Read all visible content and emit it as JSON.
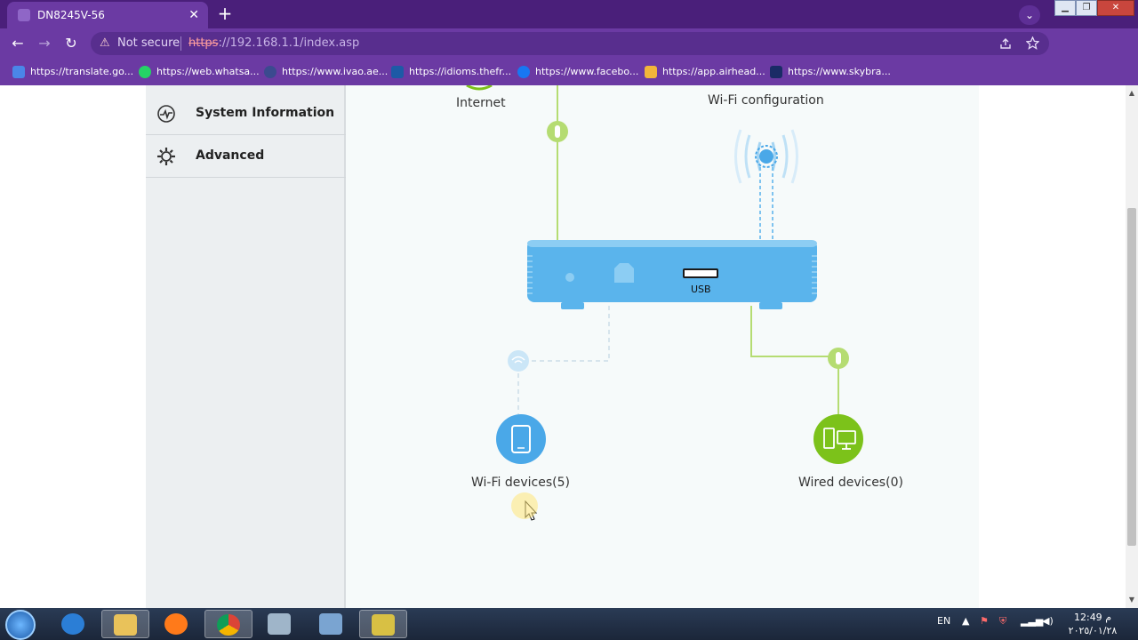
{
  "browser": {
    "tab_title": "DN8245V-56",
    "tab_close": "✕",
    "new_tab": "+",
    "tab_search": "⌄",
    "window_controls": [
      "▁",
      "❐",
      "✕"
    ],
    "nav": {
      "back": "←",
      "forward": "→",
      "reload": "↻"
    },
    "security_warning_icon": "⚠",
    "security_label": "Not secure",
    "url_scheme": "https",
    "url_rest": "://192.168.1.1/index.asp",
    "toolbar_icons": [
      "share-icon",
      "star-icon",
      "side-panel-icon",
      "profile-icon",
      "menu-icon"
    ],
    "bookmarks": [
      {
        "label": "https://translate.go...",
        "icon_color": "#4a86e8"
      },
      {
        "label": "https://web.whatsa...",
        "icon_color": "#25d366"
      },
      {
        "label": "https://www.ivao.ae...",
        "icon_color": "#3b4a8f"
      },
      {
        "label": "https://idioms.thefr...",
        "icon_color": "#1d5aa6"
      },
      {
        "label": "https://www.facebo...",
        "icon_color": "#1877f2"
      },
      {
        "label": "https://app.airhead...",
        "icon_color": "#f2b53a"
      },
      {
        "label": "https://www.skybra...",
        "icon_color": "#1a2b66"
      }
    ]
  },
  "sidebar": {
    "items": [
      {
        "label": "System Information",
        "icon": "pulse-icon"
      },
      {
        "label": "Advanced",
        "icon": "gear-icon"
      }
    ]
  },
  "topology": {
    "internet_label": "Internet",
    "wifi_config_label": "Wi-Fi configuration",
    "usb_label": "USB",
    "wifi_devices_label": "Wi-Fi devices(5)",
    "wired_devices_label": "Wired devices(0)"
  },
  "colors": {
    "browser_purple": "#6b3aa3",
    "router_blue": "#5ab4ec",
    "wifi_blue": "#4aa8e8",
    "wired_green": "#7cc21a",
    "line_green": "#b5dc72"
  },
  "taskbar": {
    "language": "EN",
    "time": "12:49 م",
    "date": "٢٠٢٥/٠١/٢٨",
    "apps": [
      "internet-explorer-icon",
      "file-explorer-icon",
      "firefox-icon",
      "chrome-icon",
      "calculator-icon",
      "network-icon",
      "video-editor-icon"
    ]
  }
}
